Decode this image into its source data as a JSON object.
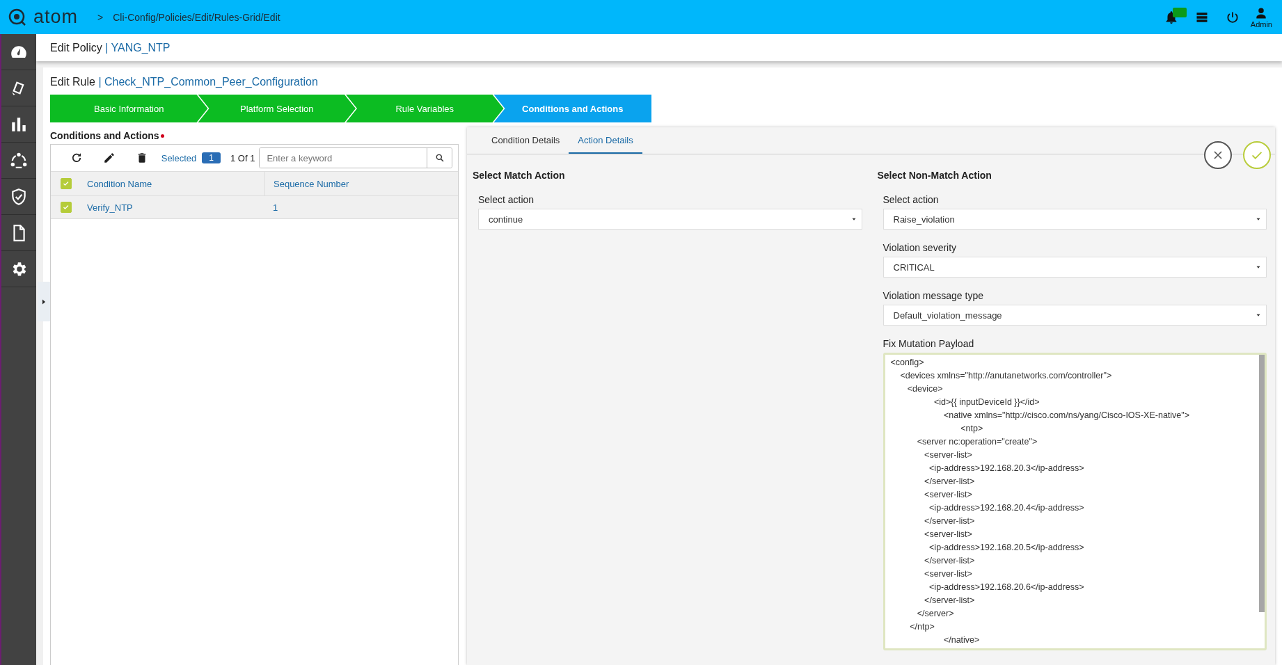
{
  "header": {
    "logo": "atom",
    "breadcrumb_sep": ">",
    "breadcrumb": "Cli-Config/Policies/Edit/Rules-Grid/Edit",
    "user": "Admin"
  },
  "policy": {
    "label": "Edit Policy",
    "sep": "|",
    "name": "YANG_NTP"
  },
  "rule": {
    "label": "Edit Rule",
    "sep": "|",
    "name": "Check_NTP_Common_Peer_Configuration"
  },
  "steps": [
    {
      "label": "Basic Information",
      "selected": false
    },
    {
      "label": "Platform Selection",
      "selected": false
    },
    {
      "label": "Rule Variables",
      "selected": false
    },
    {
      "label": "Conditions and Actions",
      "selected": true
    }
  ],
  "conditions": {
    "title": "Conditions and Actions",
    "required": true,
    "selected_label": "Selected",
    "selected_count": "1",
    "paging": "1 Of 1",
    "search": {
      "placeholder": "Enter a keyword"
    },
    "columns": [
      "Condition Name",
      "Sequence Number"
    ],
    "all_checked": true,
    "rows": [
      {
        "cells": [
          "Verify_NTP",
          "1"
        ],
        "checked": true,
        "selected": true
      }
    ]
  },
  "tabs": [
    {
      "label": "Condition Details",
      "selected": false
    },
    {
      "label": "Action Details",
      "selected": true
    }
  ],
  "match": {
    "title": "Select Match Action",
    "fields": [
      {
        "label": "Select action",
        "value": "continue"
      }
    ]
  },
  "nonmatch": {
    "title": "Select Non-Match Action",
    "fields": [
      {
        "label": "Select action",
        "value": "Raise_violation"
      },
      {
        "label": "Violation severity",
        "value": "CRITICAL"
      },
      {
        "label": "Violation message type",
        "value": "Default_violation_message"
      }
    ],
    "payload_label": "Fix Mutation Payload",
    "payload": "<config>\n    <devices xmlns=\"http://anutanetworks.com/controller\">\n       <device>\n                  <id>{{ inputDeviceId }}</id>\n                      <native xmlns=\"http://cisco.com/ns/yang/Cisco-IOS-XE-native\">\n                             <ntp>\n           <server nc:operation=\"create\">\n              <server-list>\n                <ip-address>192.168.20.3</ip-address>\n              </server-list>\n              <server-list>\n                <ip-address>192.168.20.4</ip-address>\n              </server-list>\n              <server-list>\n                <ip-address>192.168.20.5</ip-address>\n              </server-list>\n              <server-list>\n                <ip-address>192.168.20.6</ip-address>\n              </server-list>\n           </server>\n        </ntp>\n                      </native>"
  }
}
